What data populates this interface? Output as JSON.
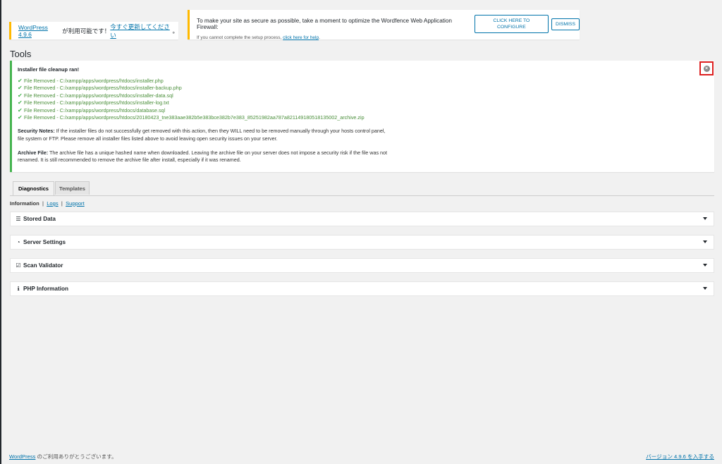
{
  "update_nag": {
    "link1": "WordPress 4.9.6",
    "text": " が利用可能です！",
    "link2": "今すぐ更新してください",
    "suffix": "。"
  },
  "wordfence": {
    "message": "To make your site as secure as possible, take a moment to optimize the Wordfence Web Application Firewall:",
    "configure_label": "CLICK HERE TO CONFIGURE",
    "dismiss_label": "DISMISS",
    "help_text": "If you cannot complete the setup process, ",
    "help_link": "click here for help",
    "help_suffix": "."
  },
  "page_title": "Tools",
  "notice": {
    "title": "Installer file cleanup ran!",
    "files": [
      "File Removed - C:/xampp/apps/wordpress/htdocs/installer.php",
      "File Removed - C:/xampp/apps/wordpress/htdocs/installer-backup.php",
      "File Removed - C:/xampp/apps/wordpress/htdocs/installer-data.sql",
      "File Removed - C:/xampp/apps/wordpress/htdocs/installer-log.txt",
      "File Removed - C:/xampp/apps/wordpress/htdocs/database.sql",
      "File Removed - C:/xampp/apps/wordpress/htdocs/20180423_tne383aae382b5e383bce382b7e383_85251982aa787a821149180518135002_archive.zip"
    ],
    "security_label": "Security Notes:",
    "security_text": " If the installer files do not successfully get removed with this action, then they WILL need to be removed manually through your hosts control panel, file system or FTP. Please remove all installer files listed above to avoid leaving open security issues on your server.",
    "archive_label": "Archive File:",
    "archive_text": " The archive file has a unique hashed name when downloaded. Leaving the archive file on your server does not impose a security risk if the file was not renamed. It is still recommended to remove the archive file after install, especially if it was renamed."
  },
  "tabs": [
    "Diagnostics",
    "Templates"
  ],
  "subnav": {
    "current": "Information",
    "sep": "  |  ",
    "logs": "Logs",
    "support": "Support"
  },
  "panels": [
    {
      "title": "Stored Data",
      "icon": "list-icon"
    },
    {
      "title": "Server Settings",
      "icon": "dashboard-icon"
    },
    {
      "title": "Scan Validator",
      "icon": "check-square-icon"
    },
    {
      "title": "PHP Information",
      "icon": "info-circle-icon"
    }
  ],
  "footer": {
    "link": "WordPress",
    "text": " のご利用ありがとうございます。",
    "version": "バージョン 4.9.6 を入手する"
  }
}
